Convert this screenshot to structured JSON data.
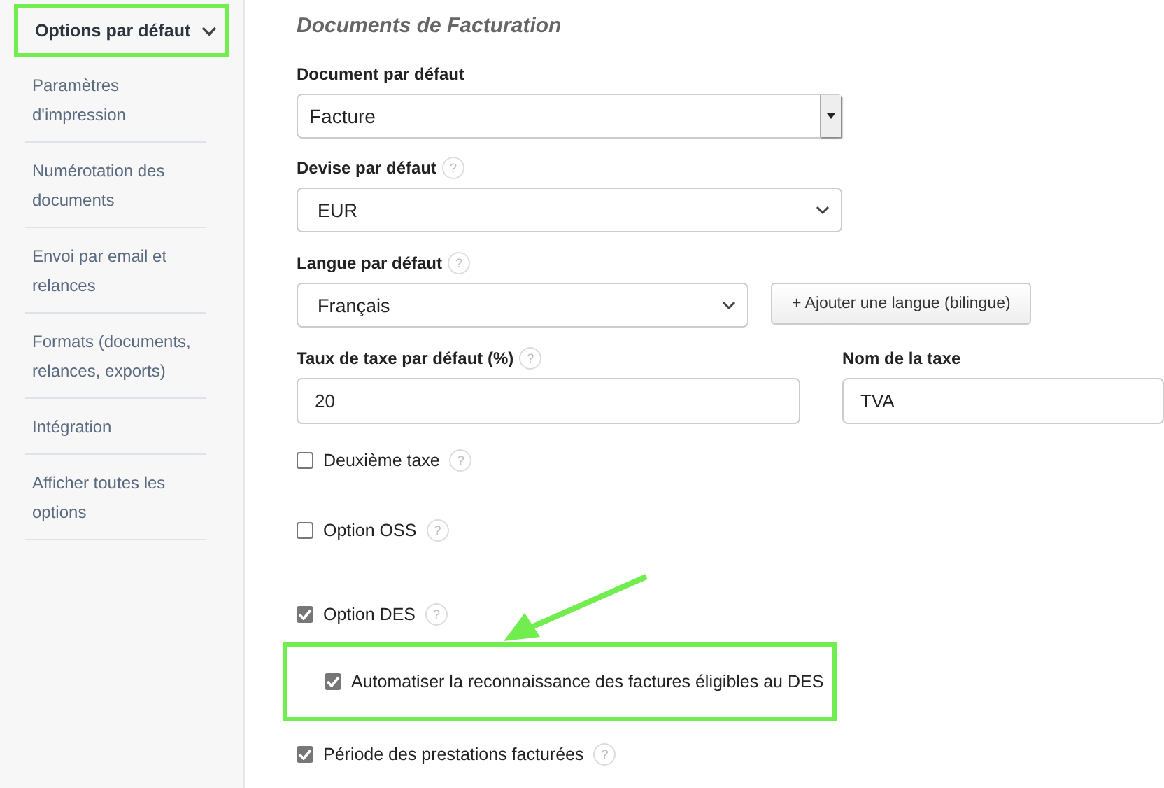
{
  "sidebar": {
    "header": {
      "label": "Options par défaut",
      "expanded": true,
      "highlighted": true
    },
    "items": [
      {
        "label": "Paramètres d'impression"
      },
      {
        "label": "Numérotation des documents"
      },
      {
        "label": "Envoi par email et relances"
      },
      {
        "label": "Formats (documents, relances, exports)"
      },
      {
        "label": "Intégration"
      },
      {
        "label": "Afficher toutes les options"
      }
    ]
  },
  "section_title": "Documents de Facturation",
  "document_field": {
    "label": "Document par défaut",
    "value": "Facture"
  },
  "currency_field": {
    "label": "Devise par défaut",
    "help": "?",
    "value": "EUR"
  },
  "language_field": {
    "label": "Langue par défaut",
    "help": "?",
    "value": "Français",
    "button": "+ Ajouter une langue (bilingue)"
  },
  "tax_rate_field": {
    "label": "Taux de taxe par défaut (%)",
    "help": "?",
    "value": "20"
  },
  "tax_name_field": {
    "label": "Nom de la taxe",
    "value": "TVA"
  },
  "checkboxes": [
    {
      "label": "Deuxième taxe",
      "checked": false,
      "help": "?"
    },
    {
      "label": "Option OSS",
      "checked": false,
      "help": "?"
    },
    {
      "label": "Option DES",
      "checked": true,
      "help": "?",
      "children": [
        {
          "label": "Automatiser la reconnaissance des factures éligibles au DES",
          "checked": true,
          "highlighted": true
        }
      ]
    },
    {
      "label": "Période des prestations facturées",
      "checked": true,
      "help": "?"
    }
  ],
  "annotation_arrow": true
}
